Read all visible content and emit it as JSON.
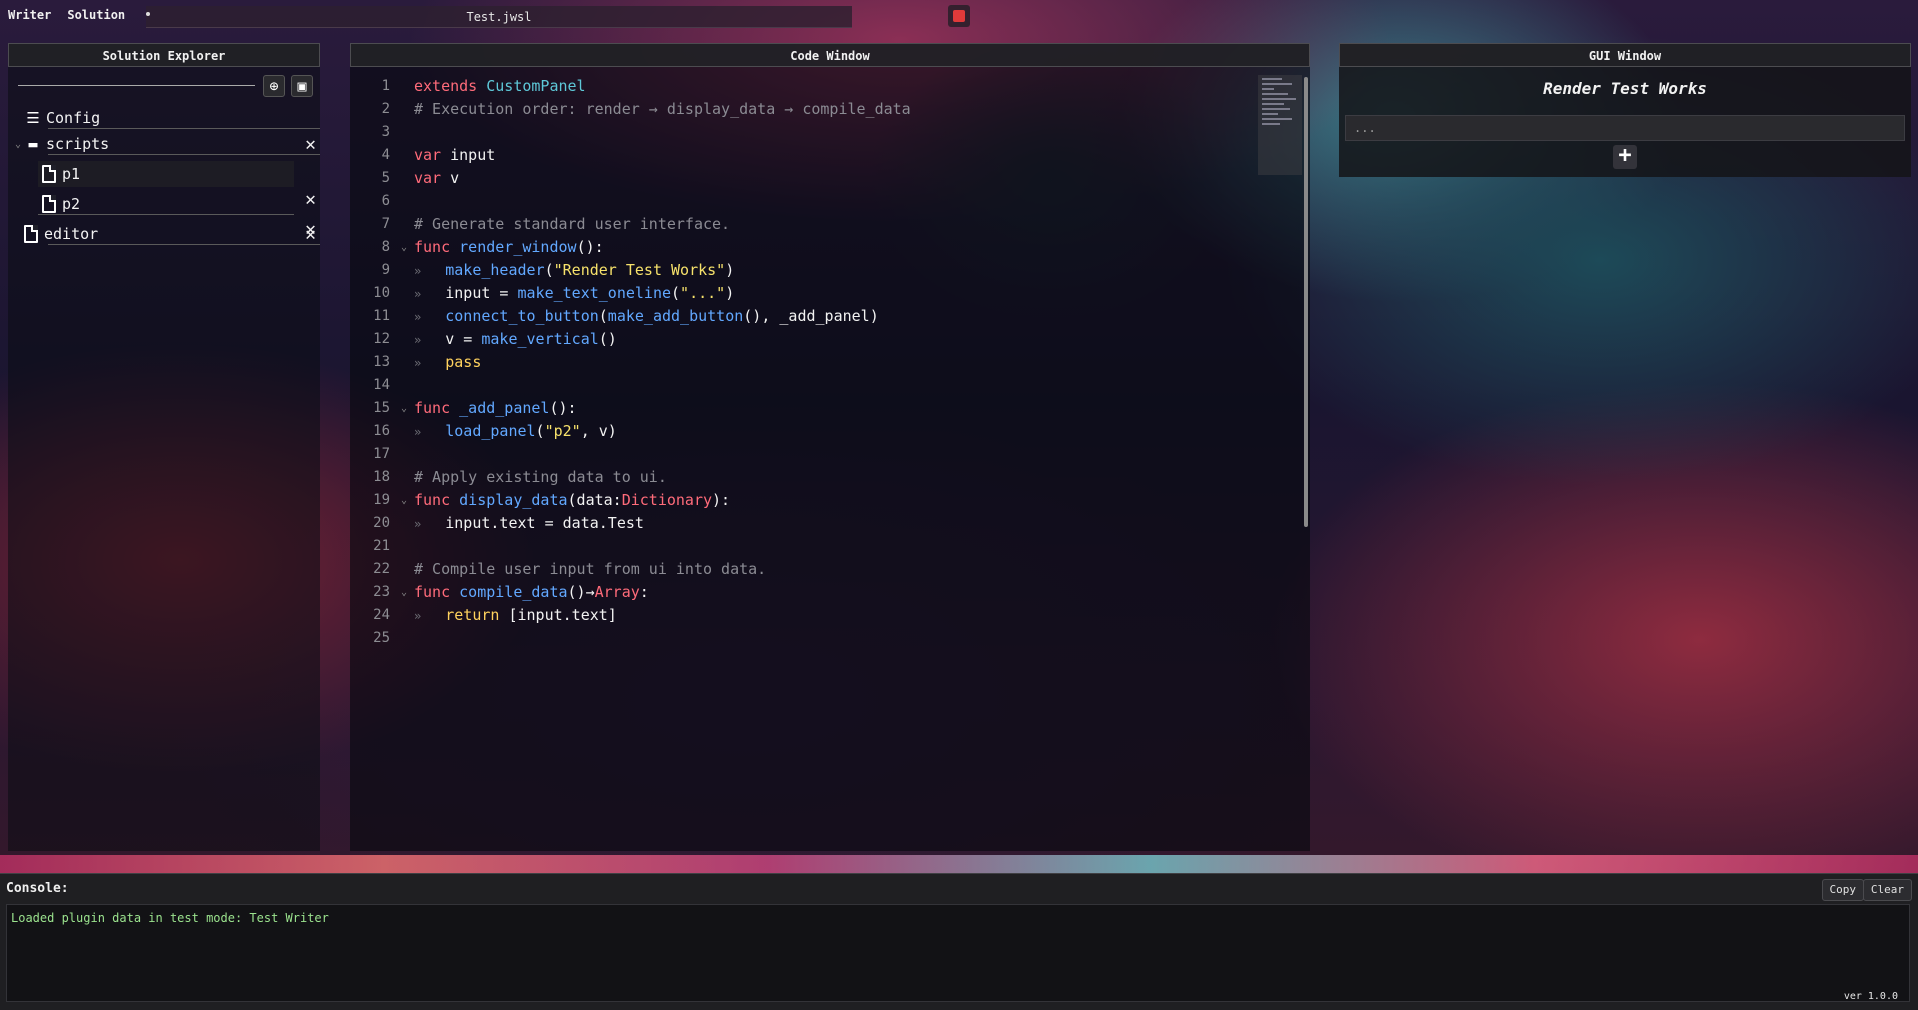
{
  "menu": {
    "writer": "Writer",
    "solution": "Solution"
  },
  "tab": {
    "title": "Test.jwsl"
  },
  "explorer": {
    "header": "Solution Explorer",
    "items": [
      {
        "label": "Config",
        "icon": "list-icon"
      },
      {
        "label": "scripts",
        "icon": "folder-icon"
      },
      {
        "label": "p1",
        "icon": "file-icon"
      },
      {
        "label": "p2",
        "icon": "file-icon"
      },
      {
        "label": "editor",
        "icon": "file-icon"
      }
    ]
  },
  "code": {
    "header": "Code Window",
    "line_numbers": [
      "1",
      "2",
      "3",
      "4",
      "5",
      "6",
      "7",
      "8",
      "9",
      "10",
      "11",
      "12",
      "13",
      "14",
      "15",
      "16",
      "17",
      "18",
      "19",
      "20",
      "21",
      "22",
      "23",
      "24",
      "25"
    ]
  },
  "gui": {
    "header": "GUI Window",
    "title": "Render Test Works",
    "input_placeholder": "...",
    "add_label": "+"
  },
  "console": {
    "label": "Console:",
    "copy": "Copy",
    "clear": "Clear",
    "output": "Loaded plugin data in test mode: Test Writer",
    "version": "ver 1.0.0"
  }
}
